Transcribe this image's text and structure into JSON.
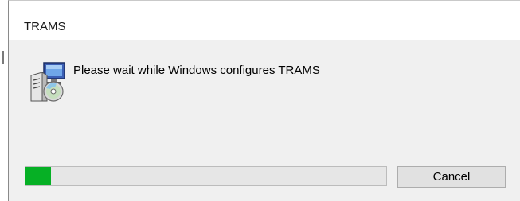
{
  "window": {
    "title": "TRAMS"
  },
  "message": "Please wait while Windows configures TRAMS",
  "progress": {
    "fraction": 0.07,
    "fill_color": "#06b025"
  },
  "buttons": {
    "cancel_label": "Cancel"
  },
  "icons": {
    "installer": "installer-computer-disc-icon"
  }
}
